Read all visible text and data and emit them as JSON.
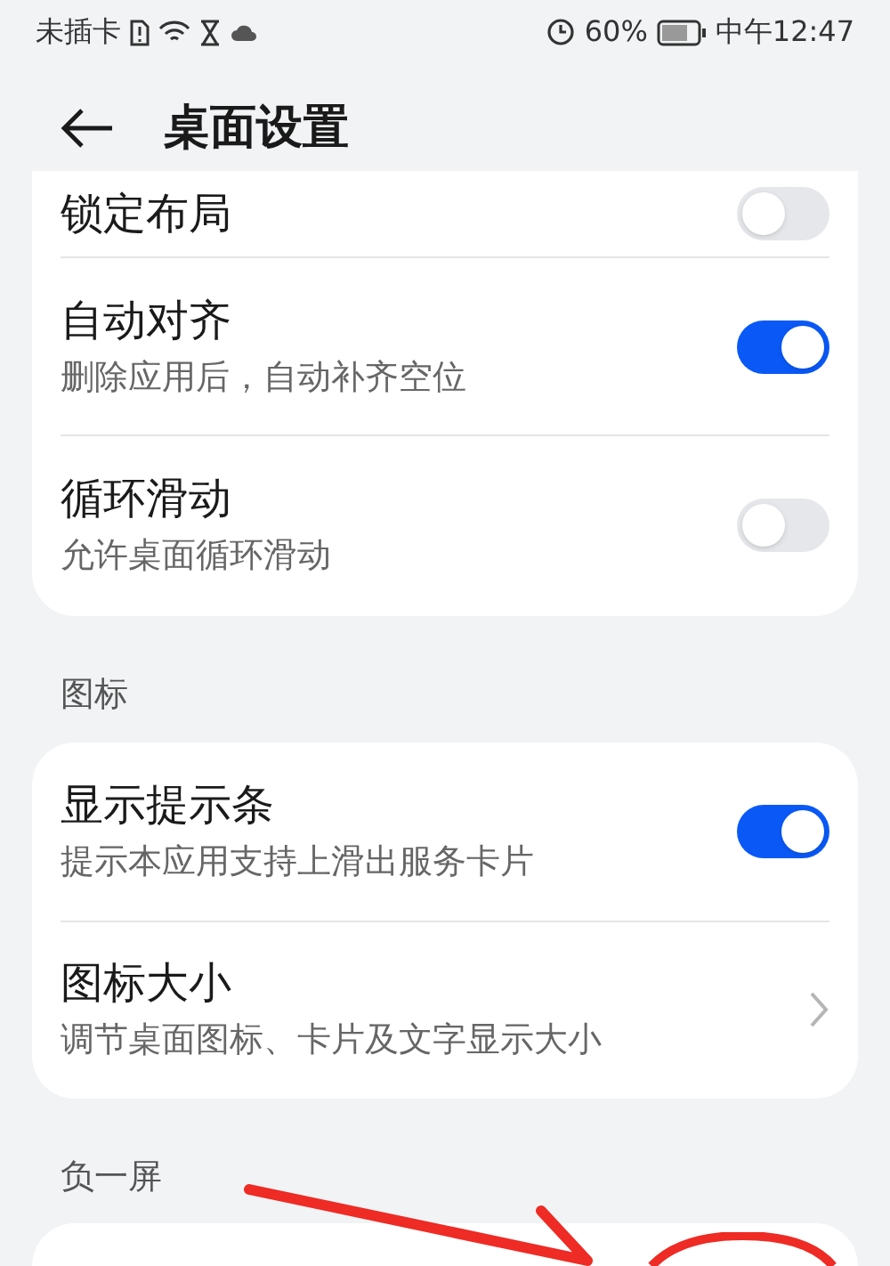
{
  "status_bar": {
    "carrier": "未插卡",
    "battery": "60%",
    "time": "中午12:47"
  },
  "header": {
    "title": "桌面设置"
  },
  "sections": [
    {
      "items": [
        {
          "kind": "toggle",
          "title": "锁定布局",
          "on": false
        },
        {
          "kind": "toggle",
          "title": "自动对齐",
          "subtitle": "删除应用后，自动补齐空位",
          "on": true
        },
        {
          "kind": "toggle",
          "title": "循环滑动",
          "subtitle": "允许桌面循环滑动",
          "on": false
        }
      ]
    },
    {
      "title": "图标",
      "items": [
        {
          "kind": "toggle",
          "title": "显示提示条",
          "subtitle": "提示本应用支持上滑出服务卡片",
          "on": true
        },
        {
          "kind": "link",
          "title": "图标大小",
          "subtitle": "调节桌面图标、卡片及文字显示大小"
        }
      ]
    },
    {
      "title": "负一屏"
    }
  ]
}
